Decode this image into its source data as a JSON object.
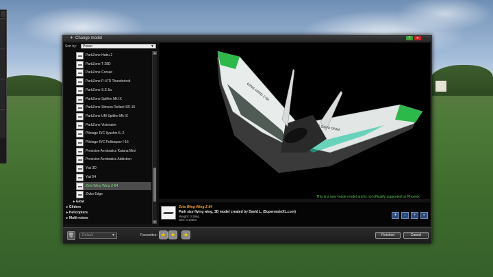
{
  "window": {
    "title": "Change model",
    "help_label": "?",
    "close_label": "✕"
  },
  "sort": {
    "label": "Sort by:",
    "value": "Power"
  },
  "model_list": [
    {
      "label": "ParkZone Habu 2"
    },
    {
      "label": "ParkZone T-28D"
    },
    {
      "label": "ParkZone Corsair"
    },
    {
      "label": "ParkZone P-47D Thunderbolt"
    },
    {
      "label": "ParkZone S.E.5a"
    },
    {
      "label": "ParkZone Spitfire Mk IX"
    },
    {
      "label": "ParkZone Stinson Reliant SR-10"
    },
    {
      "label": "ParkZone UM Spitfire Mk IX"
    },
    {
      "label": "ParkZone Visionaire"
    },
    {
      "label": "Pilotage R/C Ilyushin IL-2"
    },
    {
      "label": "Pilotage R/C Polikarpov I-15"
    },
    {
      "label": "Precision Aerobatics Katana Mini"
    },
    {
      "label": "Precision Aerobatics Addiction"
    },
    {
      "label": "Yak 3D"
    },
    {
      "label": "Yak 54"
    },
    {
      "label": "Zeta Wing Wing Z-84"
    },
    {
      "label": "Zivko Edge"
    }
  ],
  "categories": [
    {
      "label": "Glow"
    },
    {
      "label": "Gliders"
    },
    {
      "label": "Helicopters"
    },
    {
      "label": "Multi-rotors"
    }
  ],
  "preview": {
    "note": "This is a user-made model and is not officially supported by Phoenix",
    "wing_text": "WING WING Z-84"
  },
  "info": {
    "name": "Zeta Wing Wing Z-84",
    "description": "Park size flying wing, 3D model created by David L. (SupermotoXL.com)",
    "weight": "Weight: 0.35kg",
    "size": "Size: 0.845m"
  },
  "footer": {
    "preset_value": "Default",
    "favourites_label": "Favourites:",
    "finished_label": "Finished",
    "cancel_label": "Cancel"
  },
  "colors": {
    "accent_green": "#5bd15b",
    "selected_text": "#7ee07e",
    "name_orange": "#f0a020"
  }
}
